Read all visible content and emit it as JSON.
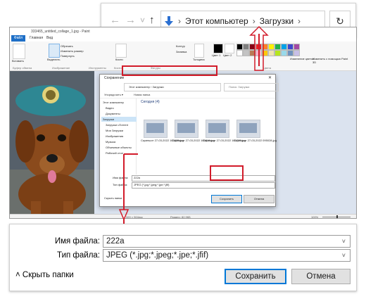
{
  "zoom_top": {
    "back_icon": "←",
    "forward_icon": "→",
    "dropdown_icon": "˅",
    "up_icon": "↑",
    "path": [
      "Этот компьютер",
      "Загрузки"
    ],
    "sep": "›",
    "refresh_icon": "↻"
  },
  "paint": {
    "title": "333465_untitled_collage_1.jpg - Paint",
    "tabs": [
      "Файл",
      "Главная",
      "Вид"
    ],
    "ribbon_groups": [
      "Буфер обмена",
      "Изображение",
      "Инструменты",
      "Кисти",
      "Фигуры",
      "Цвета"
    ],
    "ribbon_items": {
      "paste": "Вставить",
      "select": "Выделить",
      "crop": "Обрезать",
      "resize": "Изменить размер",
      "rotate": "Повернуть",
      "brushes": "Кисти",
      "outline": "Контур",
      "fill": "Заливка",
      "size": "Толщина",
      "color1": "Цвет 1",
      "color2": "Цвет 2",
      "edit_colors": "Изменение цветов",
      "paint3d": "Изменить с помощью Paint 3D"
    },
    "palette": [
      "#000000",
      "#7f7f7f",
      "#880015",
      "#ed1c24",
      "#ff7f27",
      "#fff200",
      "#22b14c",
      "#00a2e8",
      "#3f48cc",
      "#a349a4",
      "#ffffff",
      "#c3c3c3",
      "#b97a57",
      "#ffaec9",
      "#ffc90e",
      "#efe4b0",
      "#b5e61d",
      "#99d9ea",
      "#7092be",
      "#c8bfe7"
    ],
    "status": {
      "dims": "320 × 504пкс",
      "size": "Размер: 82,9КБ",
      "zoom": "100%"
    }
  },
  "dialog": {
    "title": "Сохранение",
    "close_icon": "✕",
    "address": [
      "Этот компьютер",
      "Загрузки"
    ],
    "search_placeholder": "Поиск: Загрузки",
    "organize": "Упорядочить ▾",
    "new_folder": "Новая папка",
    "sidebar": [
      "Этот компьютер",
      "Видео",
      "Документы",
      "Загрузки",
      "Загрузки uTorrent",
      "Мои Загрузки",
      "Изображения",
      "Музыка",
      "Объемные объекты",
      "Рабочий стол"
    ],
    "group": "Сегодня (4)",
    "files": [
      {
        "name": "Скриншот 27-03-2022 103023.jpg"
      },
      {
        "name": "Скриншот 27-03-2022 100816.jpg"
      },
      {
        "name": "Скриншот 27-03-2022 100727.jpg"
      },
      {
        "name": "Скриншот 27-03-2022 095028.jpg"
      }
    ],
    "filename_label": "Имя файла:",
    "filename_value": "222a",
    "filetype_label": "Тип файла:",
    "filetype_value": "JPEG (*.jpg;*.jpeg;*.jpe;*.jfif)",
    "hide_folders": "Скрыть папки",
    "save": "Сохранить",
    "cancel": "Отмена"
  },
  "zoom_bottom": {
    "filename_label": "Имя файла:",
    "filename_value": "222a",
    "filetype_label": "Тип файла:",
    "filetype_value": "JPEG (*.jpg;*.jpeg;*.jpe;*.jfif)",
    "hide_label": "Скрыть папки",
    "save": "Сохранить",
    "cancel": "Отмена",
    "caret_icon": "˅",
    "hide_icon": "˄"
  },
  "colors": {
    "highlight": "#d21b2a",
    "accent": "#0078d7"
  }
}
